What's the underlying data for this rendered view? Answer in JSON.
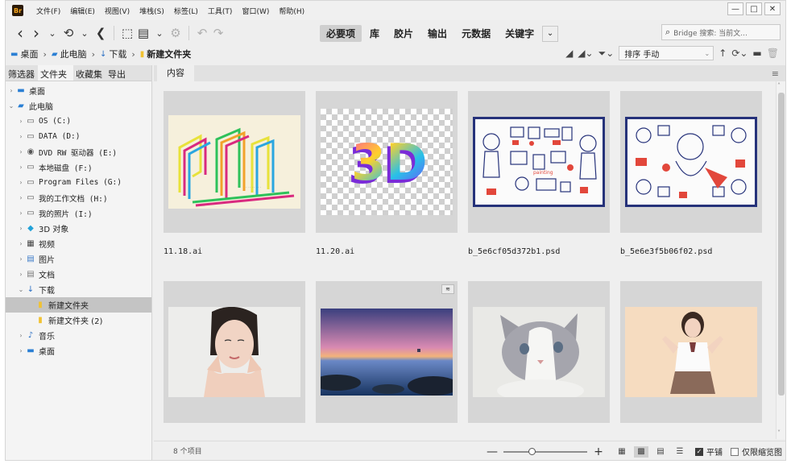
{
  "app": {
    "logo_text": "Br"
  },
  "menu": [
    "文件(F)",
    "编辑(E)",
    "视图(V)",
    "堆栈(S)",
    "标签(L)",
    "工具(T)",
    "窗口(W)",
    "帮助(H)"
  ],
  "window_controls": {
    "minimize": "—",
    "maximize": "□",
    "close": "✕"
  },
  "toolbar": {
    "icons": {
      "back": "‹",
      "forward": "›",
      "dropdown": "⌄",
      "history": "⟲",
      "boomerang": "❮",
      "camera": "⬚",
      "refine": "▤",
      "rotate_left": "↶",
      "rotate_right": "↷"
    },
    "workspaces": [
      "必要项",
      "库",
      "胶片",
      "输出",
      "元数据",
      "关键字"
    ],
    "active_workspace": "必要项",
    "workspace_more": "⌄",
    "search_placeholder": "Bridge 搜索: 当前文..."
  },
  "breadcrumb": {
    "items": [
      {
        "label": "桌面",
        "icon": "desktop-icon"
      },
      {
        "label": "此电脑",
        "icon": "computer-icon"
      },
      {
        "label": "下载",
        "icon": "download-icon"
      },
      {
        "label": "新建文件夹",
        "icon": "folder-icon"
      }
    ],
    "separator": "›"
  },
  "sort": {
    "label": "排序 手动",
    "arrow": "↑"
  },
  "left_panel": {
    "tabs": [
      "筛选器",
      "文件夹",
      "收藏集",
      "导出"
    ],
    "active_tab": "文件夹",
    "tree": [
      {
        "label": "桌面",
        "level": 0,
        "arrow": "›",
        "icon": "▬",
        "color": "#2a7fd4",
        "mono": false
      },
      {
        "label": "此电脑",
        "level": 0,
        "arrow": "⌄",
        "icon": "▰",
        "color": "#2a7fd4",
        "mono": false
      },
      {
        "label": "OS (C:)",
        "level": 1,
        "arrow": "›",
        "icon": "▭",
        "color": "#555",
        "mono": true
      },
      {
        "label": "DATA (D:)",
        "level": 1,
        "arrow": "›",
        "icon": "▭",
        "color": "#555",
        "mono": true
      },
      {
        "label": "DVD RW 驱动器 (E:)",
        "level": 1,
        "arrow": "›",
        "icon": "◉",
        "color": "#555",
        "mono": true
      },
      {
        "label": "本地磁盘 (F:)",
        "level": 1,
        "arrow": "›",
        "icon": "▭",
        "color": "#555",
        "mono": true
      },
      {
        "label": "Program Files (G:)",
        "level": 1,
        "arrow": "›",
        "icon": "▭",
        "color": "#555",
        "mono": true
      },
      {
        "label": "我的工作文档 (H:)",
        "level": 1,
        "arrow": "›",
        "icon": "▭",
        "color": "#555",
        "mono": true
      },
      {
        "label": "我的照片 (I:)",
        "level": 1,
        "arrow": "›",
        "icon": "▭",
        "color": "#555",
        "mono": true
      },
      {
        "label": "3D 对象",
        "level": 1,
        "arrow": "›",
        "icon": "◆",
        "color": "#22a2d8",
        "mono": false
      },
      {
        "label": "视频",
        "level": 1,
        "arrow": "›",
        "icon": "▦",
        "color": "#444",
        "mono": false
      },
      {
        "label": "图片",
        "level": 1,
        "arrow": "›",
        "icon": "▤",
        "color": "#3b7ac7",
        "mono": false
      },
      {
        "label": "文档",
        "level": 1,
        "arrow": "›",
        "icon": "▤",
        "color": "#777",
        "mono": false
      },
      {
        "label": "下载",
        "level": 1,
        "arrow": "⌄",
        "icon": "↓",
        "color": "#2a6fc4",
        "mono": false
      },
      {
        "label": "新建文件夹",
        "level": 2,
        "arrow": "",
        "icon": "▮",
        "color": "#f1c232",
        "mono": false,
        "selected": true
      },
      {
        "label": "新建文件夹 (2)",
        "level": 2,
        "arrow": "",
        "icon": "▮",
        "color": "#f1c232",
        "mono": false
      },
      {
        "label": "音乐",
        "level": 1,
        "arrow": "›",
        "icon": "♪",
        "color": "#2a6fc4",
        "mono": false
      },
      {
        "label": "桌面",
        "level": 1,
        "arrow": "›",
        "icon": "▬",
        "color": "#2a7fd4",
        "mono": false
      }
    ]
  },
  "content": {
    "tab_label": "内容",
    "menu_icon": "≡",
    "files": [
      {
        "name": "11.18.ai",
        "kind": "logo-lines"
      },
      {
        "name": "11.20.ai",
        "kind": "logo-3d"
      },
      {
        "name": "b_5e6cf05d372b1.psd",
        "kind": "illustration-a"
      },
      {
        "name": "b_5e6e3f5b06f02.psd",
        "kind": "illustration-b"
      },
      {
        "name": "",
        "kind": "portrait"
      },
      {
        "name": "",
        "kind": "seascape",
        "badge": "≋"
      },
      {
        "name": "",
        "kind": "cat"
      },
      {
        "name": "",
        "kind": "girl"
      }
    ]
  },
  "status": {
    "items_count": "8 个项目",
    "zoom_minus": "—",
    "zoom_plus": "+",
    "zoom_level": 0.3,
    "tile_label": "平铺",
    "tile_checked": true,
    "thumb_only_label": "仅限缩览图",
    "thumb_only_checked": false
  },
  "colors": {
    "accent": "#2a7fd4",
    "panel": "#efefef",
    "thumb_bg": "#d6d6d6",
    "selection": "#c4c4c4"
  }
}
